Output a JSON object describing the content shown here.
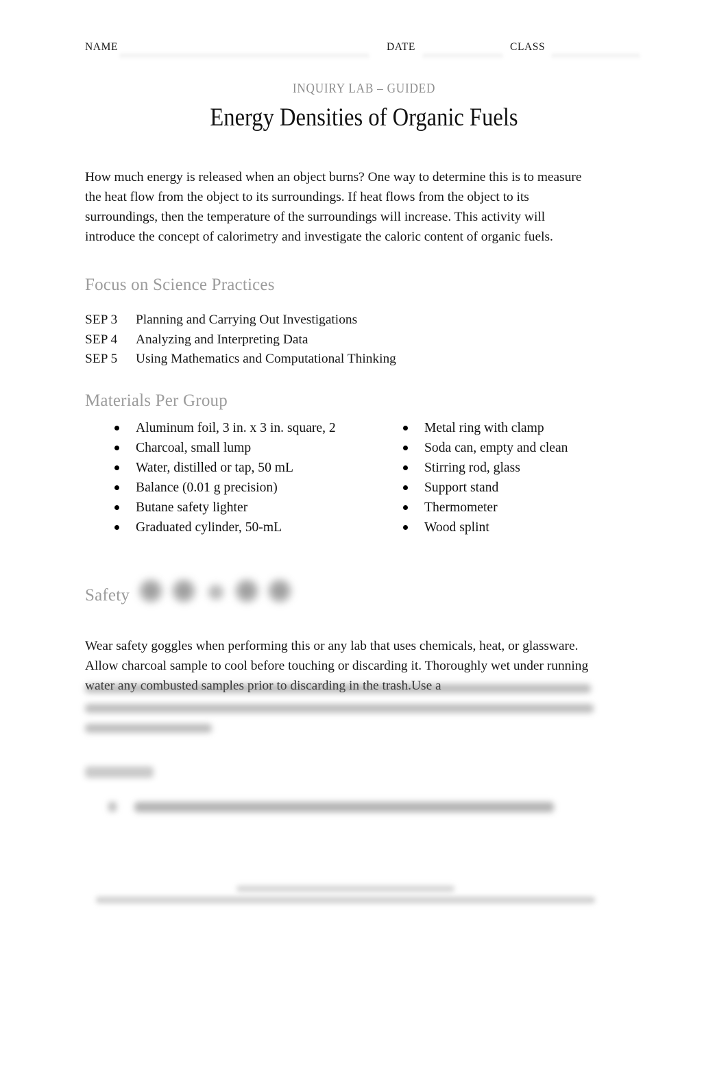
{
  "document": {
    "kicker": "INQUIRY LAB – GUIDED",
    "title": "Energy Densities of Organic Fuels",
    "intro": "How much energy is released when an object burns? One way to determine this is to measure the heat flow from the object to its surroundings. If heat flows from the object to its surroundings, then the temperature of the surroundings will increase. This activity will introduce the concept of calorimetry and investigate the caloric content of organic fuels."
  },
  "header": {
    "name_label": "NAME",
    "date_label": "DATE",
    "class_label": "CLASS",
    "name_value": "",
    "date_value": "",
    "class_value": ""
  },
  "sections": {
    "science_practices": {
      "heading": "Focus on Science Practices",
      "items": [
        {
          "code": "SEP 3",
          "label": "Planning and Carrying Out Investigations"
        },
        {
          "code": "SEP 4",
          "label": "Analyzing and Interpreting Data"
        },
        {
          "code": "SEP 5",
          "label": "Using Mathematics and Computational Thinking"
        }
      ]
    },
    "materials": {
      "heading": "Materials Per Group",
      "left_column": [
        "Aluminum foil, 3 in. x 3 in. square, 2",
        "Charcoal, small lump",
        "Water, distilled or tap, 50 mL",
        "Balance (0.01 g precision)",
        "Butane safety lighter",
        "Graduated cylinder, 50-mL"
      ],
      "right_column": [
        "Metal ring with clamp",
        "Soda can, empty and clean",
        "Stirring rod, glass",
        "Support stand",
        "Thermometer",
        "Wood splint"
      ]
    },
    "safety": {
      "heading": "Safety",
      "icons": [
        "safety-goggles-icon",
        "lab-apron-icon",
        "flame-hazard-icon",
        "gloves-icon",
        "hand-wash-icon"
      ],
      "text": "Wear safety goggles when performing this or any lab that uses chemicals, heat, or glassware. Allow charcoal sample to cool before touching or discarding it. Thoroughly wet under running water any combusted samples prior to discarding in the trash.Use a"
    },
    "procedure": {
      "heading": "",
      "items": [
        ""
      ]
    }
  },
  "footer": {
    "line1": "",
    "line2": ""
  },
  "colors": {
    "heading_gray": "#9c9c9c",
    "kicker_gray": "#8e8e8e",
    "body_text": "#161616",
    "page_background": "#ffffff"
  }
}
